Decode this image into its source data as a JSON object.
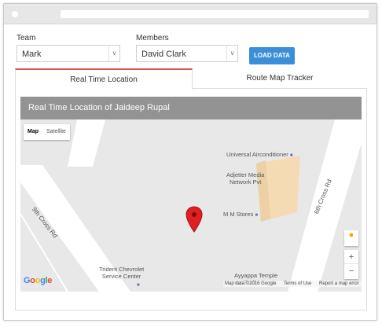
{
  "form": {
    "team_label": "Team",
    "team_value": "Mark",
    "members_label": "Members",
    "members_value": "David Clark",
    "load_button": "LOAD DATA"
  },
  "tabs": [
    {
      "label": "Real Time Location",
      "active": true
    },
    {
      "label": "Route Map Tracker",
      "active": false
    }
  ],
  "map": {
    "title": "Real Time Location of Jaideep Rupal",
    "type_map": "Map",
    "type_satellite": "Satellite",
    "labels": {
      "universal": "Universal Airconditioner",
      "adjetter": "Adjetter Media\nNetwork Pvt",
      "mm_stores": "M M Stores",
      "cross9": "9th Cross Rd",
      "cross6": "6th Cross Rd",
      "trident": "Trident Chevrolet\nService Center",
      "ayyappa": "Ayyappa Temple\nKodihalli"
    },
    "zoom_in": "+",
    "zoom_out": "−",
    "google_logo": "Google",
    "attribution": [
      "Map data ©2016 Google",
      "Terms of Use",
      "Report a map error"
    ]
  },
  "colors": {
    "accent_blue": "#3b8fd9",
    "tab_active_border": "#d9534f",
    "map_header": "#939393",
    "marker": "#e02020"
  }
}
